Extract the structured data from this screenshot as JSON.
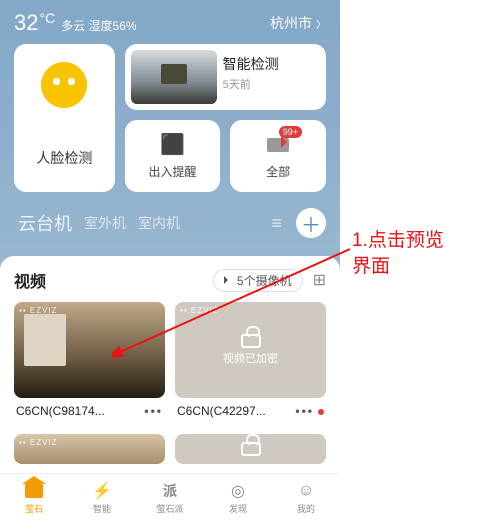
{
  "weather": {
    "temp": "32",
    "unit": "°C",
    "cond": "多云 湿度56%",
    "city": "杭州市"
  },
  "cards": {
    "face": "人脸检测",
    "detect_title": "智能检测",
    "detect_sub": "5天前",
    "door": "出入提醒",
    "all": "全部",
    "badge": "99+"
  },
  "tabs": {
    "t1": "云台机",
    "t2": "室外机",
    "t3": "室内机"
  },
  "video": {
    "title": "视频",
    "cam_count": "5个摄像机",
    "locked": "视频已加密",
    "cam1": "C6CN(C98174...",
    "cam2": "C6CN(C42297...",
    "dots": "•••"
  },
  "nav": {
    "n1": "萤石",
    "n2": "智能",
    "n3": "萤石派",
    "n3_icon": "派",
    "n4": "发现",
    "n5": "我的"
  },
  "annotation": {
    "line1": "1.点击预览",
    "line2": "界面"
  }
}
